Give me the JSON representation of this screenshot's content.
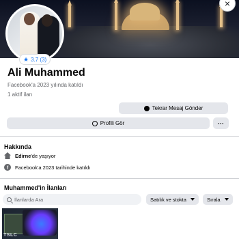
{
  "profile": {
    "name": "Ali Muhammed",
    "joined": "Facebook'a 2023 yılında katıldı",
    "active_listings": "1 aktif ilan",
    "rating": "3.7 (3)"
  },
  "actions": {
    "message_label": "Tekrar Mesaj Gönder",
    "profile_label": "Profili Gör",
    "more_label": "···",
    "close_label": "×"
  },
  "about": {
    "title": "Hakkında",
    "location_city": "Edirne",
    "location_suffix": "'de yaşıyor",
    "facebook_joined": "Facebook'a 2023 tarihinde katıldı"
  },
  "listings": {
    "title": "Muhammed'in İlanları",
    "search_placeholder": "İlanlarda Ara",
    "filter_label": "Satılık ve stokta",
    "sort_label": "Sırala",
    "thumb_brand": "TSLC"
  },
  "colors": {
    "accent": "#1877f2",
    "button_bg": "#e4e6eb",
    "muted_text": "#65676b"
  },
  "icons": {
    "rating": "star-icon",
    "message": "messenger-icon",
    "profile": "person-icon",
    "location": "home-icon",
    "facebook": "facebook-icon",
    "search": "search-icon",
    "dropdown": "caret-down-icon"
  }
}
